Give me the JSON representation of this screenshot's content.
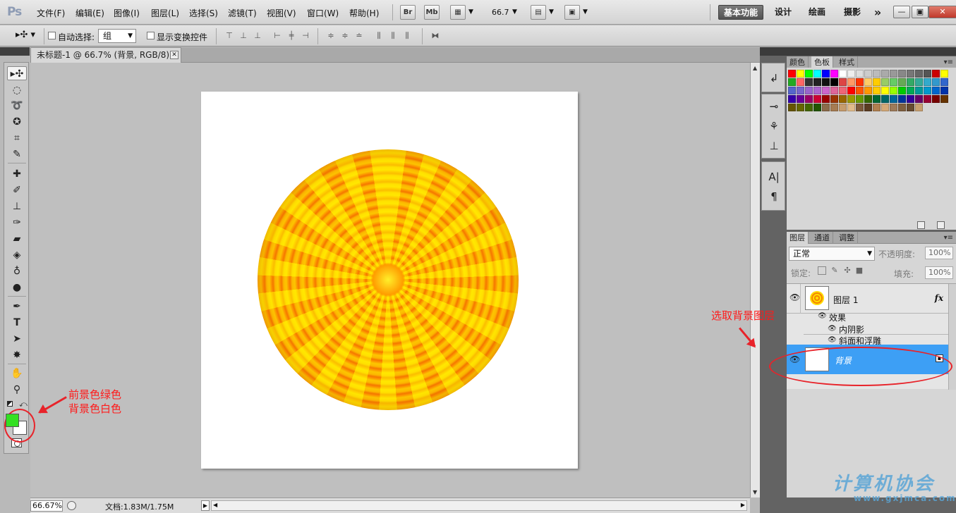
{
  "menubar": {
    "logo": "Ps",
    "items": [
      "文件(F)",
      "编辑(E)",
      "图像(I)",
      "图层(L)",
      "选择(S)",
      "滤镜(T)",
      "视图(V)",
      "窗口(W)",
      "帮助(H)"
    ],
    "bridge_label": "Br",
    "minibridge_label": "Mb",
    "zoom_value": "66.7",
    "workspaces": [
      "基本功能",
      "设计",
      "绘画",
      "摄影"
    ],
    "more_label": "»",
    "window_buttons": [
      "—",
      "▣",
      "✕"
    ]
  },
  "options": {
    "auto_select_label": "自动选择:",
    "auto_select_value": "组",
    "show_transform_label": "显示变换控件"
  },
  "document": {
    "tab_title": "未标题-1 @ 66.7% (背景, RGB/8) *",
    "close_glyph": "✕"
  },
  "status": {
    "zoom": "66.67%",
    "doc_size": "文档:1.83M/1.75M"
  },
  "swatch_panel": {
    "tabs": [
      "颜色",
      "色板",
      "样式"
    ],
    "active_tab": "色板",
    "colors": [
      "#ff0000",
      "#ffff00",
      "#00ff00",
      "#00ffff",
      "#0000ff",
      "#ff00ff",
      "#ffffff",
      "#eeeeee",
      "#dddddd",
      "#cccccc",
      "#bbbbbb",
      "#aaaaaa",
      "#999999",
      "#888888",
      "#777777",
      "#666666",
      "#555555",
      "#cc0000",
      "#ffff00",
      "#22aa22",
      "#ff6666",
      "#333333",
      "#222222",
      "#111111",
      "#000000",
      "#dd4444",
      "#ff9966",
      "#ff3300",
      "#ffcc66",
      "#ffcc00",
      "#99cc66",
      "#66cc66",
      "#66aa55",
      "#33aa66",
      "#33aa99",
      "#33aacc",
      "#3399cc",
      "#3366cc",
      "#5566cc",
      "#7766cc",
      "#9966cc",
      "#aa66cc",
      "#cc66cc",
      "#dd6699",
      "#ee6677",
      "#ff0000",
      "#ff5500",
      "#ff9900",
      "#ffcc00",
      "#ffff00",
      "#99ff00",
      "#00cc00",
      "#00aa55",
      "#009999",
      "#0099cc",
      "#0066cc",
      "#0033aa",
      "#3300aa",
      "#660099",
      "#990066",
      "#cc0033",
      "#990000",
      "#993300",
      "#996600",
      "#999900",
      "#669900",
      "#336600",
      "#006633",
      "#006666",
      "#006699",
      "#003399",
      "#330099",
      "#660066",
      "#990033",
      "#770000",
      "#663300",
      "#665500",
      "#666600",
      "#446600",
      "#225500",
      "#8b6b4a",
      "#a67c52",
      "#c69c6d",
      "#e0bb8a",
      "#7d5a3a",
      "#5a3d22",
      "#b08050",
      "#d4a978",
      "#9e7b5a",
      "#806040",
      "#664a30",
      "#c8a070"
    ]
  },
  "layers_panel": {
    "tabs": [
      "图层",
      "通道",
      "调整"
    ],
    "active_tab": "图层",
    "blend_mode": "正常",
    "opacity_label": "不透明度:",
    "opacity_value": "100%",
    "lock_label": "锁定:",
    "fill_label": "填充:",
    "fill_value": "100%",
    "layers": [
      {
        "name": "图层 1",
        "has_fx": true,
        "fx_label": "fx"
      },
      {
        "name": "背景",
        "selected": true,
        "locked": true
      }
    ],
    "effects_label": "效果",
    "effects": [
      "内阴影",
      "斜面和浮雕"
    ]
  },
  "annotations": {
    "fg_color_note": "前景色绿色",
    "bg_color_note": "背景色白色",
    "select_layer_note": "选取背景图层",
    "annotation_color": "#ff1a1a"
  },
  "watermark": {
    "text": "计算机协会",
    "url": "www.gxjmca.com"
  },
  "colors": {
    "foreground": "#33e022",
    "background": "#ffffff",
    "selected_layer": "#3d9ff5"
  }
}
